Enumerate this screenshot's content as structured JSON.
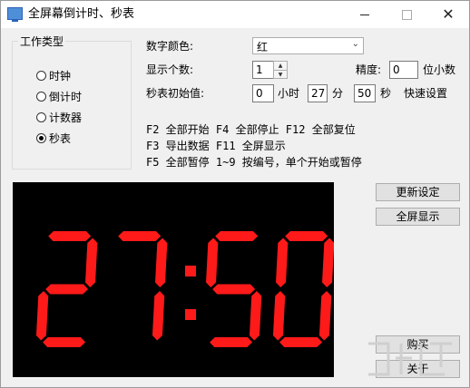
{
  "window": {
    "title": "全屏幕倒计时、秒表",
    "icon": "monitor-icon",
    "close_glyph": "✕"
  },
  "mode_group": {
    "title": "工作类型",
    "options": [
      {
        "label": "时钟",
        "selected": false
      },
      {
        "label": "倒计时",
        "selected": false
      },
      {
        "label": "计数器",
        "selected": false
      },
      {
        "label": "秒表",
        "selected": true
      }
    ]
  },
  "settings": {
    "color_label": "数字颜色:",
    "color_value": "红",
    "count_label": "显示个数:",
    "count_value": "1",
    "precision_label": "精度:",
    "precision_value": "0",
    "precision_unit": "位小数",
    "init_label": "秒表初始值:",
    "hours_value": "0",
    "hours_unit": "小时",
    "minutes_value": "27",
    "minutes_unit": "分",
    "seconds_value": "50",
    "seconds_unit": "秒",
    "quick_label": "快速设置"
  },
  "hints": [
    "F2 全部开始 F4 全部停止 F12 全部复位",
    "F3 导出数据 F11 全屏显示",
    "F5 全部暂停 1~9 按编号，单个开始或暂停"
  ],
  "display": {
    "text": "27:50",
    "digit_color": "#ff1a1a",
    "background": "#000000"
  },
  "buttons": {
    "update": "更新设定",
    "fullscreen": "全屏显示",
    "buy": "购买",
    "about": "关于"
  }
}
